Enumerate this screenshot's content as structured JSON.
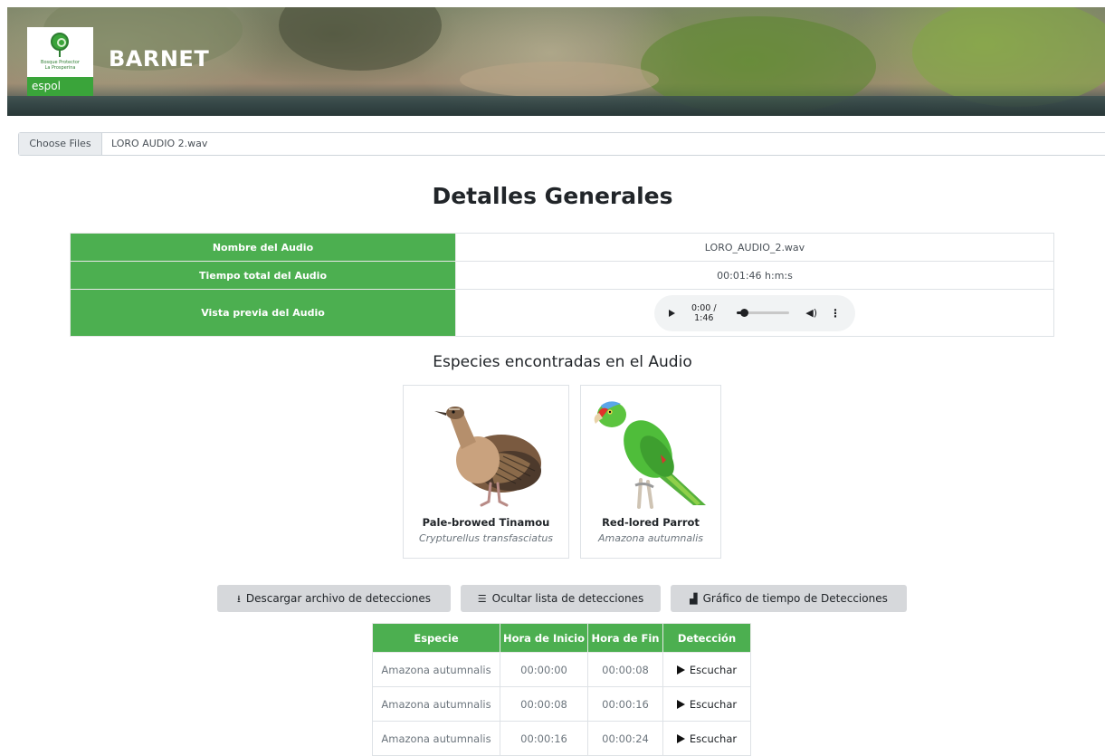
{
  "header": {
    "brand": "BARNET",
    "logo_small_text_1": "Bosque Protector",
    "logo_small_text_2": "La Prosperina",
    "logo_strip_text": "espol"
  },
  "file_input": {
    "button_label": "Choose Files",
    "file_name": "LORO AUDIO 2.wav"
  },
  "general": {
    "title": "Detalles Generales",
    "rows": [
      {
        "label": "Nombre del Audio",
        "value": "LORO_AUDIO_2.wav"
      },
      {
        "label": "Tiempo total del Audio",
        "value": "00:01:46 h:m:s"
      },
      {
        "label": "Vista previa del Audio",
        "value": ""
      }
    ],
    "player": {
      "time": "0:00 / 1:46",
      "progress": 0.0,
      "volume_icon": "volume-icon",
      "menu_icon": "more-vert-icon"
    }
  },
  "species": {
    "title": "Especies encontradas en el Audio",
    "items": [
      {
        "common": "Pale-browed Tinamou",
        "scientific": "Crypturellus transfasciatus",
        "icon": "tinamou-illustration"
      },
      {
        "common": "Red-lored Parrot",
        "scientific": "Amazona autumnalis",
        "icon": "parrot-illustration"
      }
    ]
  },
  "actions": {
    "download": {
      "label": "Descargar archivo de detecciones",
      "icon": "download-icon"
    },
    "toggle_list": {
      "label": "Ocultar lista de detecciones",
      "icon": "list-icon"
    },
    "chart": {
      "label": "Gráfico de tiempo de Detecciones",
      "icon": "chart-icon"
    }
  },
  "detections": {
    "headers": [
      "Especie",
      "Hora de Inicio",
      "Hora de Fin",
      "Detección"
    ],
    "rows": [
      {
        "species": "Amazona autumnalis",
        "start": "00:00:00",
        "end": "00:00:08",
        "action": "Escuchar"
      },
      {
        "species": "Amazona autumnalis",
        "start": "00:00:08",
        "end": "00:00:16",
        "action": "Escuchar"
      },
      {
        "species": "Amazona autumnalis",
        "start": "00:00:16",
        "end": "00:00:24",
        "action": "Escuchar"
      }
    ]
  },
  "colors": {
    "accent_green": "#4caf50",
    "button_gray": "#d6d8db"
  }
}
